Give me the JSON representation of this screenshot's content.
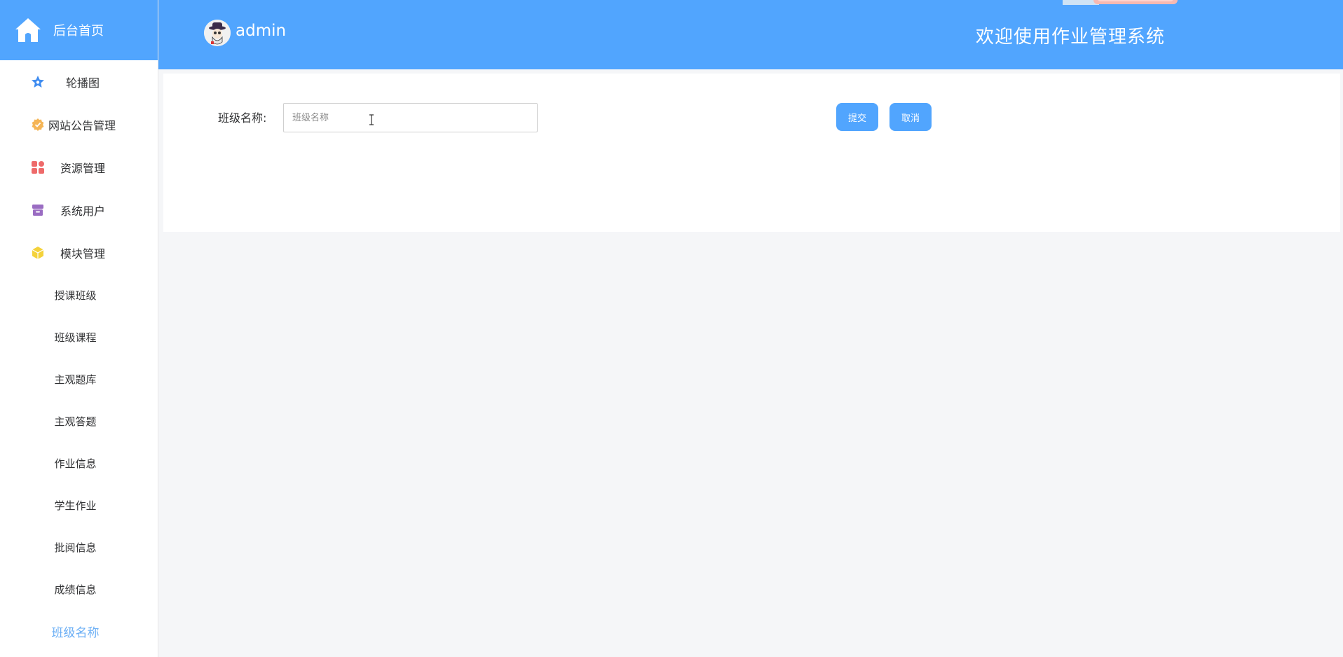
{
  "sidebar": {
    "home_label": "后台首页",
    "items": [
      {
        "label": "轮播图",
        "icon": "star-icon",
        "color": "#3f8cf0"
      },
      {
        "label": "网站公告管理",
        "icon": "badge-icon",
        "color": "#f5b556"
      },
      {
        "label": "资源管理",
        "icon": "grid-icon",
        "color": "#ee6a6a"
      },
      {
        "label": "系统用户",
        "icon": "archive-icon",
        "color": "#9a6cc2"
      },
      {
        "label": "模块管理",
        "icon": "cube-icon",
        "color": "#f4d23b"
      }
    ],
    "subitems": [
      {
        "label": "授课班级"
      },
      {
        "label": "班级课程"
      },
      {
        "label": "主观题库"
      },
      {
        "label": "主观答题"
      },
      {
        "label": "作业信息"
      },
      {
        "label": "学生作业"
      },
      {
        "label": "批阅信息"
      },
      {
        "label": "成绩信息"
      },
      {
        "label": "班级名称"
      }
    ],
    "active_subitem": "班级名称"
  },
  "header": {
    "username": "admin",
    "welcome": "欢迎使用作业管理系统"
  },
  "form": {
    "label": "班级名称:",
    "input_value": "",
    "input_placeholder": "班级名称",
    "submit_label": "提交",
    "cancel_label": "取消"
  },
  "colors": {
    "accent": "#51a5fe",
    "active_text": "#6aaef5"
  }
}
